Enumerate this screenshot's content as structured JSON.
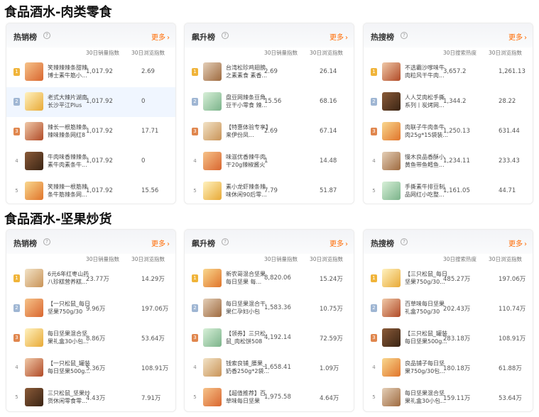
{
  "sections": [
    {
      "title": "食品酒水-肉类零食",
      "cards": [
        {
          "title": "热销榜",
          "more": "更多",
          "col1": "30日销量指数",
          "col2": "30日浏览指数",
          "rows": [
            {
              "rank": "1",
              "name": "笑辣辣辣条甜辣博士素牛筋小...",
              "v1": "1,017.92",
              "v2": "2.69"
            },
            {
              "rank": "2",
              "name": "老式大辣片湖南长沙平江Plus辣...",
              "v1": "1,017.92",
              "v2": "0"
            },
            {
              "rank": "3",
              "name": "辣长一根筋辣条辣味辣条网红80%...",
              "v1": "1,017.92",
              "v2": "17.71"
            },
            {
              "rank": "4",
              "name": "牛肉味香辣辣条素牛肉素条牛...",
              "v1": "1,017.92",
              "v2": "0"
            },
            {
              "rank": "5",
              "name": "笑辣辣一根筋辣条牛筋辣条网...",
              "v1": "1,017.92",
              "v2": "15.56"
            }
          ]
        },
        {
          "title": "飙升榜",
          "more": "更多",
          "col1": "30日销量指数",
          "col2": "30日浏览指数",
          "rows": [
            {
              "rank": "1",
              "name": "台湾松珍鸡翅膀之素素食 素香...",
              "v1": "2.69",
              "v2": "26.14"
            },
            {
              "rank": "2",
              "name": "盘豆网辣条豆角豆干小零食 辣...",
              "v1": "15.56",
              "v2": "68.16"
            },
            {
              "rank": "3",
              "name": "【特惠体验专享】来伊份凤...",
              "v1": "2.69",
              "v2": "67.14"
            },
            {
              "rank": "4",
              "name": "味滋优香辣牛肉干20g辣椒酱火锅...",
              "v1": "1",
              "v2": "14.48"
            },
            {
              "rank": "5",
              "name": "素小龙虾辣条辣味休闲90后零...",
              "v1": "7.79",
              "v2": "51.87"
            }
          ]
        },
        {
          "title": "热搜榜",
          "more": "更多",
          "col1": "30日搜索热度",
          "col2": "30日浏览指数",
          "rows": [
            {
              "rank": "1",
              "name": "不选霸沙嗲味牛肉粒风干牛肉...",
              "v1": "3,657.2",
              "v2": "1,261.13"
            },
            {
              "rank": "2",
              "name": "人人艾肉松手撕系列丨炭烤网...",
              "v1": "1,344.2",
              "v2": "28.22"
            },
            {
              "rank": "3",
              "name": "肉联子牛肉条牛肉25g*15袋装...",
              "v1": "1,250.13",
              "v2": "631.44"
            },
            {
              "rank": "4",
              "name": "慢木良品香酥小黄鱼带鱼鳕鱼...",
              "v1": "1,234.11",
              "v2": "233.43"
            },
            {
              "rank": "5",
              "name": "手撕素牛排豆制品网红小吃整...",
              "v1": "1,161.05",
              "v2": "44.71"
            }
          ]
        }
      ]
    },
    {
      "title": "食品酒水-坚果炒货",
      "cards": [
        {
          "title": "热销榜",
          "more": "更多",
          "col1": "30日销量指数",
          "col2": "30日浏览指数",
          "rows": [
            {
              "rank": "1",
              "name": "6元6年红枣山药八珍糕营养糕...",
              "v1": "23.77万",
              "v2": "14.29万"
            },
            {
              "rank": "2",
              "name": "【一只松鼠_每日坚果750g/30包...",
              "v1": "9.96万",
              "v2": "197.06万"
            },
            {
              "rank": "3",
              "name": "每日坚果混合坚果礼盒30小包...",
              "v1": "8.86万",
              "v2": "53.64万"
            },
            {
              "rank": "4",
              "name": "【一只松鼠_罐装每日坚果500g...",
              "v1": "5.36万",
              "v2": "108.91万"
            },
            {
              "rank": "5",
              "name": "三只松鼠_坚果炒货休闲零食零...",
              "v1": "4.43万",
              "v2": "7.91万"
            }
          ]
        },
        {
          "title": "飙升榜",
          "more": "更多",
          "col1": "30日销量指数",
          "col2": "30日浏览指数",
          "rows": [
            {
              "rank": "1",
              "name": "新农哥混合坚果每日坚果 每...",
              "v1": "8,820.06",
              "v2": "15.24万"
            },
            {
              "rank": "2",
              "name": "每日坚果混合干果仁孕妇小包装...",
              "v1": "1,583.36",
              "v2": "10.75万"
            },
            {
              "rank": "3",
              "name": "【领券】三只松鼠_肉松饼508g...",
              "v1": "4,192.14",
              "v2": "72.59万"
            },
            {
              "rank": "4",
              "name": "钱索良铺_腰果_奶香250g*2袋...",
              "v1": "1,658.41",
              "v2": "1.09万"
            },
            {
              "rank": "5",
              "name": "【超值推荐】百草味每日坚果混...",
              "v1": "1,975.58",
              "v2": "4.64万"
            }
          ]
        },
        {
          "title": "热搜榜",
          "more": "更多",
          "col1": "30日搜索热度",
          "col2": "30日浏览指数",
          "rows": [
            {
              "rank": "1",
              "name": "【三只松鼠_每日坚果750g/30...",
              "v1": "485.27万",
              "v2": "197.06万"
            },
            {
              "rank": "2",
              "name": "百草味每日坚果礼盒750g/30包...",
              "v1": "202.43万",
              "v2": "110.74万"
            },
            {
              "rank": "3",
              "name": "【三只松鼠_罐装每日坚果500g...",
              "v1": "283.18万",
              "v2": "108.91万"
            },
            {
              "rank": "4",
              "name": "良品铺子每日坚果750g/30包...",
              "v1": "180.18万",
              "v2": "61.88万"
            },
            {
              "rank": "5",
              "name": "每日坚果混合坚果礼盒30小包...",
              "v1": "159.11万",
              "v2": "53.64万"
            }
          ]
        }
      ]
    }
  ]
}
